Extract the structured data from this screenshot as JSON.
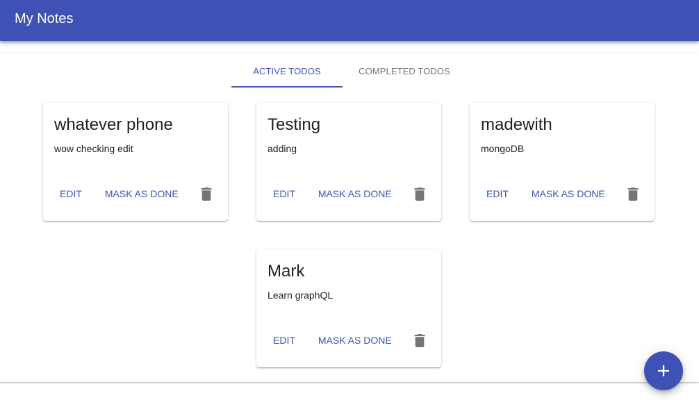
{
  "app": {
    "title": "My Notes"
  },
  "tabs": [
    {
      "label": "ACTIVE TODOS",
      "active": true
    },
    {
      "label": "COMPLETED TODOS",
      "active": false
    }
  ],
  "actions": {
    "edit_label": "EDIT",
    "done_label": "MASK AS DONE",
    "delete_icon": "trash-icon"
  },
  "notes": [
    {
      "title": "whatever phone",
      "body": "wow checking edit"
    },
    {
      "title": "Testing",
      "body": "adding"
    },
    {
      "title": "madewith",
      "body": "mongoDB"
    },
    {
      "title": "Mark",
      "body": "Learn graphQL"
    }
  ],
  "fab": {
    "icon": "plus-icon"
  },
  "colors": {
    "primary": "#3f51b5",
    "icon_grey": "#757575",
    "text": "#212121"
  }
}
